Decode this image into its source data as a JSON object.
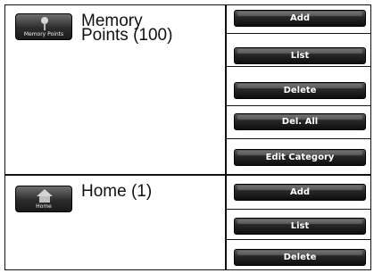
{
  "sections": [
    {
      "icon_name": "memory-points-icon",
      "icon_caption": "Memory Points",
      "label_line1": "Memory",
      "label_line2": "Points (100)",
      "buttons": [
        "Add",
        "List",
        "Delete",
        "Del. All",
        "Edit Category"
      ]
    },
    {
      "icon_name": "home-icon",
      "icon_caption": "Home",
      "label_line1": "Home (1)",
      "buttons": [
        "Add",
        "List",
        "Delete"
      ]
    }
  ]
}
